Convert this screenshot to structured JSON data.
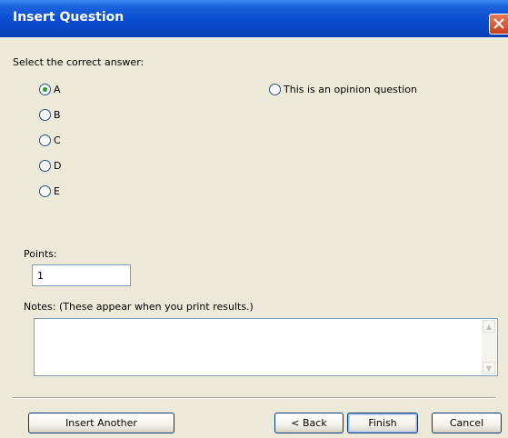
{
  "window": {
    "title": "Insert Question"
  },
  "prompt": "Select the correct answer:",
  "answers": [
    {
      "label": "A",
      "selected": true
    },
    {
      "label": "B",
      "selected": false
    },
    {
      "label": "C",
      "selected": false
    },
    {
      "label": "D",
      "selected": false
    },
    {
      "label": "E",
      "selected": false
    }
  ],
  "opinion_option": {
    "label": "This is an opinion question",
    "selected": false
  },
  "points": {
    "label": "Points:",
    "value": "1"
  },
  "notes": {
    "label": "Notes: (These appear when you print results.)",
    "value": ""
  },
  "buttons": {
    "insert_another": "Insert Another",
    "back": "< Back",
    "finish": "Finish",
    "cancel": "Cancel"
  },
  "colors": {
    "title_bar": "#0a4ed3",
    "dialog_bg": "#ece9d8",
    "radio_dot": "#21a121",
    "close_button": "#c8401d"
  }
}
